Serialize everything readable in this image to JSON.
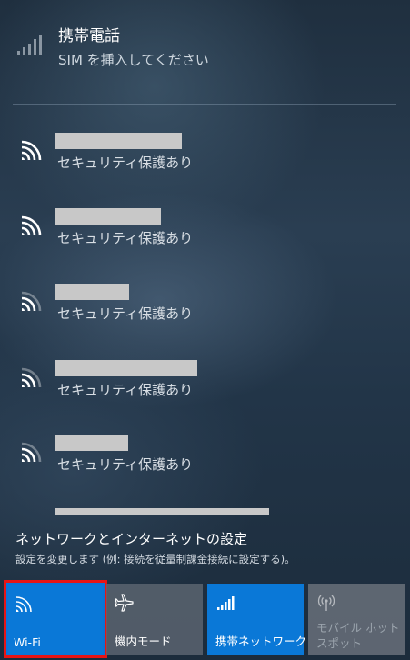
{
  "cellular": {
    "icon": "cellular-signal-icon",
    "title": "携帯電話",
    "subtitle": "SIM を挿入してください"
  },
  "networks": [
    {
      "status": "セキュリティ保護あり",
      "icon": "wifi-signal-icon"
    },
    {
      "status": "セキュリティ保護あり",
      "icon": "wifi-signal-icon"
    },
    {
      "status": "セキュリティ保護あり",
      "icon": "wifi-signal-icon"
    },
    {
      "status": "セキュリティ保護あり",
      "icon": "wifi-signal-icon"
    },
    {
      "status": "セキュリティ保護あり",
      "icon": "wifi-signal-icon"
    }
  ],
  "settings": {
    "link": "ネットワークとインターネットの設定",
    "description": "設定を変更します (例: 接続を従量制課金接続に設定する)。"
  },
  "tiles": {
    "wifi": {
      "label": "Wi-Fi",
      "icon": "wifi-icon",
      "state": "on",
      "highlight_color": "#e81414"
    },
    "airplane": {
      "label": "機内モード",
      "icon": "airplane-icon",
      "state": "off"
    },
    "cellular": {
      "label": "携帯ネットワーク",
      "icon": "cellular-icon",
      "state": "on"
    },
    "hotspot": {
      "label": "モバイル ホットスポット",
      "icon": "hotspot-icon",
      "state": "disabled"
    }
  },
  "colors": {
    "accent": "#0a78d7",
    "tile_off": "#5a6470",
    "tile_disabled": "#68707a",
    "highlight_border": "#e81414"
  }
}
